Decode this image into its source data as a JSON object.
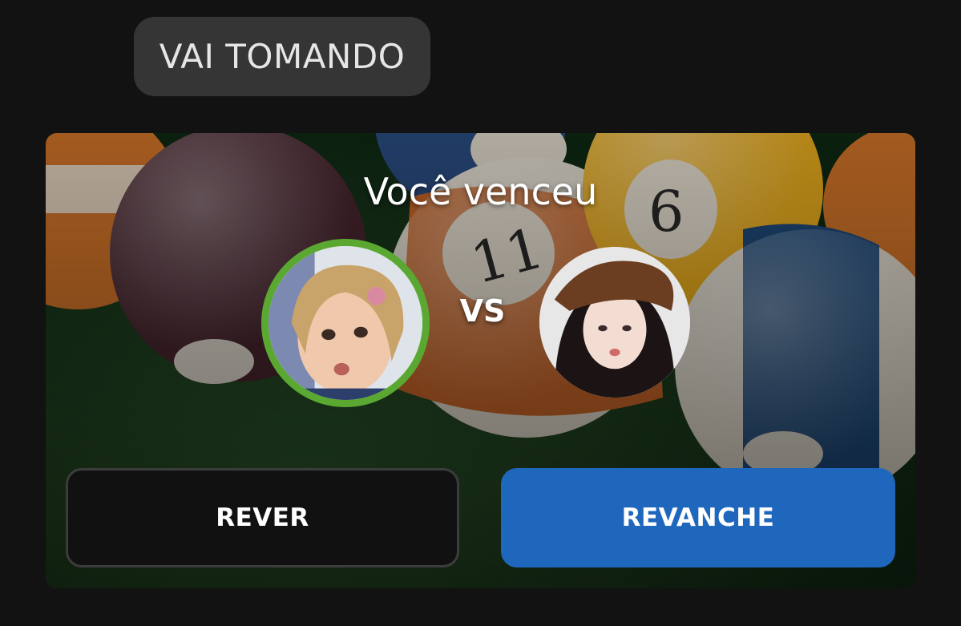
{
  "header": {
    "label": "VAI TOMANDO"
  },
  "result_card": {
    "title": "Você venceu",
    "vs_label": "VS",
    "winner_ring_color": "#5aa832",
    "background_image": "billiard-balls-on-green-felt",
    "players": [
      {
        "role": "winner",
        "avatar": "player-avatar-blonde-hair"
      },
      {
        "role": "opponent",
        "avatar": "player-avatar-brown-hat"
      }
    ]
  },
  "actions": {
    "replay_label": "REVER",
    "rematch_label": "REVANCHE",
    "rematch_color": "#1f67bd"
  }
}
